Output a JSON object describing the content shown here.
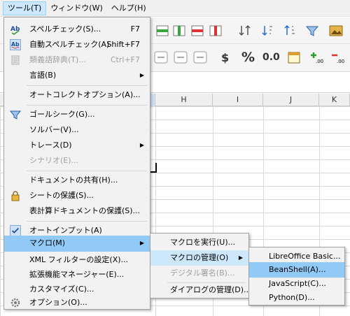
{
  "menubar": {
    "items": [
      {
        "label": "ツール(T)",
        "active": true
      },
      {
        "label": "ウィンドウ(W)",
        "active": false
      },
      {
        "label": "ヘルプ(H)",
        "active": false
      }
    ]
  },
  "toolbar": {
    "dollar": "$",
    "percent": "%",
    "decimal": "0.0"
  },
  "sheet": {
    "columns": [
      "H",
      "I",
      "J",
      "K"
    ]
  },
  "tools_menu": {
    "items": [
      {
        "label": "スペルチェック(S)...",
        "shortcut": "F7",
        "icon": "spellcheck-icon"
      },
      {
        "label": "自動スペルチェック(A)",
        "shortcut": "Shift+F7",
        "icon": "auto-spellcheck-icon"
      },
      {
        "label": "類義語辞典(T)...",
        "shortcut": "Ctrl+F7",
        "icon": "thesaurus-icon",
        "disabled": true
      },
      {
        "label": "言語(B)",
        "submenu": true
      },
      {
        "label": "オートコレクトオプション(A)..."
      },
      {
        "label": "ゴールシーク(G)...",
        "icon": "goal-seek-icon"
      },
      {
        "label": "ソルバー(V)..."
      },
      {
        "label": "トレース(D)",
        "submenu": true
      },
      {
        "label": "シナリオ(E)...",
        "disabled": true
      },
      {
        "label": "ドキュメントの共有(H)..."
      },
      {
        "label": "シートの保護(S)...",
        "icon": "lock-icon"
      },
      {
        "label": "表計算ドキュメントの保護(S)..."
      },
      {
        "label": "オートインプット(A)",
        "icon": "checkmark-icon"
      },
      {
        "label": "マクロ(M)",
        "submenu": true,
        "highlighted": true
      },
      {
        "label": "XML フィルターの設定(X)..."
      },
      {
        "label": "拡張機能マネージャー(E)..."
      },
      {
        "label": "カスタマイズ(C)..."
      },
      {
        "label": "オプション(O)...",
        "icon": "gear-icon"
      }
    ]
  },
  "macro_menu": {
    "items": [
      {
        "label": "マクロを実行(U)..."
      },
      {
        "label": "マクロの管理(O)",
        "submenu": true
      },
      {
        "label": "デジタル署名(B)...",
        "disabled": true
      },
      {
        "label": "ダイアログの管理(D)..."
      }
    ]
  },
  "manage_menu": {
    "items": [
      {
        "label": "LibreOffice Basic..."
      },
      {
        "label": "BeanShell(A)..."
      },
      {
        "label": "JavaScript(C)..."
      },
      {
        "label": "Python(D)..."
      }
    ]
  },
  "colors": {
    "highlight": "#91c9f7",
    "menu_bg": "#f2f2f2"
  }
}
